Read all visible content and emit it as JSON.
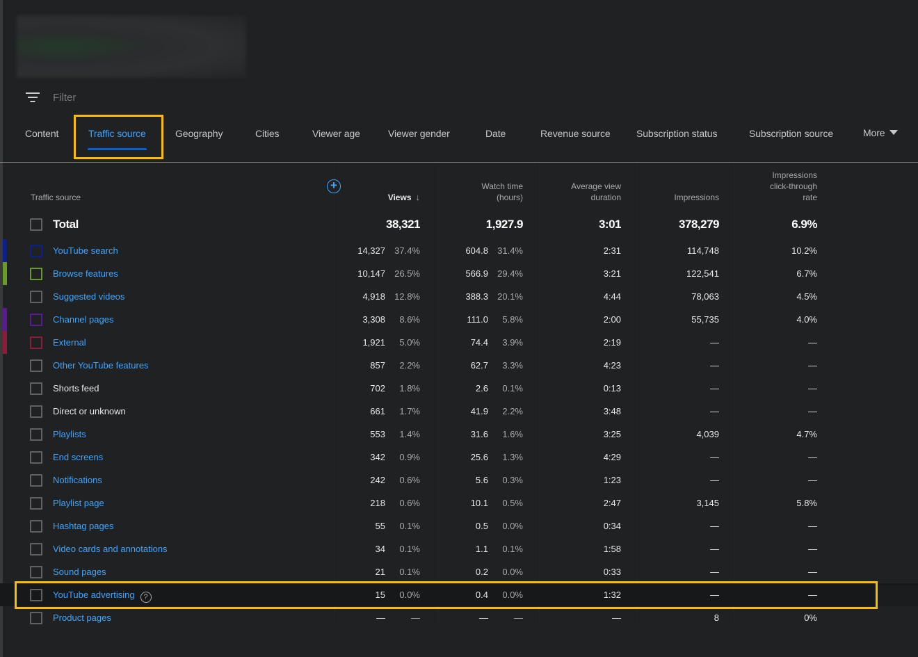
{
  "filter": {
    "placeholder": "Filter"
  },
  "tabs": [
    {
      "label": "Content",
      "active": false
    },
    {
      "label": "Traffic source",
      "active": true
    },
    {
      "label": "Geography",
      "active": false
    },
    {
      "label": "Cities",
      "active": false
    },
    {
      "label": "Viewer age",
      "active": false
    },
    {
      "label": "Viewer gender",
      "active": false
    },
    {
      "label": "Date",
      "active": false
    },
    {
      "label": "Revenue source",
      "active": false
    },
    {
      "label": "Subscription status",
      "active": false
    },
    {
      "label": "Subscription source",
      "active": false
    },
    {
      "label": "More",
      "active": false
    }
  ],
  "columns": {
    "source": "Traffic source",
    "views": "Views",
    "watch_time_line1": "Watch time",
    "watch_time_line2": "(hours)",
    "avd_line1": "Average view",
    "avd_line2": "duration",
    "impressions": "Impressions",
    "ctr_line1": "Impressions",
    "ctr_line2": "click-through",
    "ctr_line3": "rate",
    "sort_icon": "arrow-down-icon",
    "add_metric_icon": "plus-circle-icon"
  },
  "total": {
    "label": "Total",
    "views": "38,321",
    "watch_time": "1,927.9",
    "avd": "3:01",
    "impressions": "378,279",
    "ctr": "6.9%"
  },
  "colors": {
    "accent": "#3ea6ff",
    "highlight": "#fbbc04",
    "youtube_search": "#0d1f8c",
    "browse_features": "#6b9a2a",
    "channel_pages": "#5a1a91",
    "external": "#8c1c3c"
  },
  "rows": [
    {
      "label": "YouTube search",
      "link": true,
      "color": "#0d1f8c",
      "views": "14,327",
      "views_pct": "37.4%",
      "watch": "604.8",
      "watch_pct": "31.4%",
      "avd": "2:31",
      "impressions": "114,748",
      "ctr": "10.2%"
    },
    {
      "label": "Browse features",
      "link": true,
      "color": "#6b9a2a",
      "views": "10,147",
      "views_pct": "26.5%",
      "watch": "566.9",
      "watch_pct": "29.4%",
      "avd": "3:21",
      "impressions": "122,541",
      "ctr": "6.7%"
    },
    {
      "label": "Suggested videos",
      "link": true,
      "color": "",
      "views": "4,918",
      "views_pct": "12.8%",
      "watch": "388.3",
      "watch_pct": "20.1%",
      "avd": "4:44",
      "impressions": "78,063",
      "ctr": "4.5%"
    },
    {
      "label": "Channel pages",
      "link": true,
      "color": "#5a1a91",
      "views": "3,308",
      "views_pct": "8.6%",
      "watch": "111.0",
      "watch_pct": "5.8%",
      "avd": "2:00",
      "impressions": "55,735",
      "ctr": "4.0%"
    },
    {
      "label": "External",
      "link": true,
      "color": "#8c1c3c",
      "views": "1,921",
      "views_pct": "5.0%",
      "watch": "74.4",
      "watch_pct": "3.9%",
      "avd": "2:19",
      "impressions": "—",
      "ctr": "—"
    },
    {
      "label": "Other YouTube features",
      "link": true,
      "color": "",
      "views": "857",
      "views_pct": "2.2%",
      "watch": "62.7",
      "watch_pct": "3.3%",
      "avd": "4:23",
      "impressions": "—",
      "ctr": "—"
    },
    {
      "label": "Shorts feed",
      "link": false,
      "color": "",
      "views": "702",
      "views_pct": "1.8%",
      "watch": "2.6",
      "watch_pct": "0.1%",
      "avd": "0:13",
      "impressions": "—",
      "ctr": "—"
    },
    {
      "label": "Direct or unknown",
      "link": false,
      "color": "",
      "views": "661",
      "views_pct": "1.7%",
      "watch": "41.9",
      "watch_pct": "2.2%",
      "avd": "3:48",
      "impressions": "—",
      "ctr": "—"
    },
    {
      "label": "Playlists",
      "link": true,
      "color": "",
      "views": "553",
      "views_pct": "1.4%",
      "watch": "31.6",
      "watch_pct": "1.6%",
      "avd": "3:25",
      "impressions": "4,039",
      "ctr": "4.7%"
    },
    {
      "label": "End screens",
      "link": true,
      "color": "",
      "views": "342",
      "views_pct": "0.9%",
      "watch": "25.6",
      "watch_pct": "1.3%",
      "avd": "4:29",
      "impressions": "—",
      "ctr": "—"
    },
    {
      "label": "Notifications",
      "link": true,
      "color": "",
      "views": "242",
      "views_pct": "0.6%",
      "watch": "5.6",
      "watch_pct": "0.3%",
      "avd": "1:23",
      "impressions": "—",
      "ctr": "—"
    },
    {
      "label": "Playlist page",
      "link": true,
      "color": "",
      "views": "218",
      "views_pct": "0.6%",
      "watch": "10.1",
      "watch_pct": "0.5%",
      "avd": "2:47",
      "impressions": "3,145",
      "ctr": "5.8%"
    },
    {
      "label": "Hashtag pages",
      "link": true,
      "color": "",
      "views": "55",
      "views_pct": "0.1%",
      "watch": "0.5",
      "watch_pct": "0.0%",
      "avd": "0:34",
      "impressions": "—",
      "ctr": "—"
    },
    {
      "label": "Video cards and annotations",
      "link": true,
      "color": "",
      "views": "34",
      "views_pct": "0.1%",
      "watch": "1.1",
      "watch_pct": "0.1%",
      "avd": "1:58",
      "impressions": "—",
      "ctr": "—"
    },
    {
      "label": "Sound pages",
      "link": true,
      "color": "",
      "views": "21",
      "views_pct": "0.1%",
      "watch": "0.2",
      "watch_pct": "0.0%",
      "avd": "0:33",
      "impressions": "—",
      "ctr": "—"
    },
    {
      "label": "YouTube advertising",
      "link": true,
      "color": "",
      "help": true,
      "highlighted": true,
      "views": "15",
      "views_pct": "0.0%",
      "watch": "0.4",
      "watch_pct": "0.0%",
      "avd": "1:32",
      "impressions": "—",
      "ctr": "—"
    },
    {
      "label": "Product pages",
      "link": true,
      "color": "",
      "views": "—",
      "views_pct": "—",
      "watch": "—",
      "watch_pct": "—",
      "avd": "—",
      "impressions": "8",
      "ctr": "0%"
    }
  ]
}
